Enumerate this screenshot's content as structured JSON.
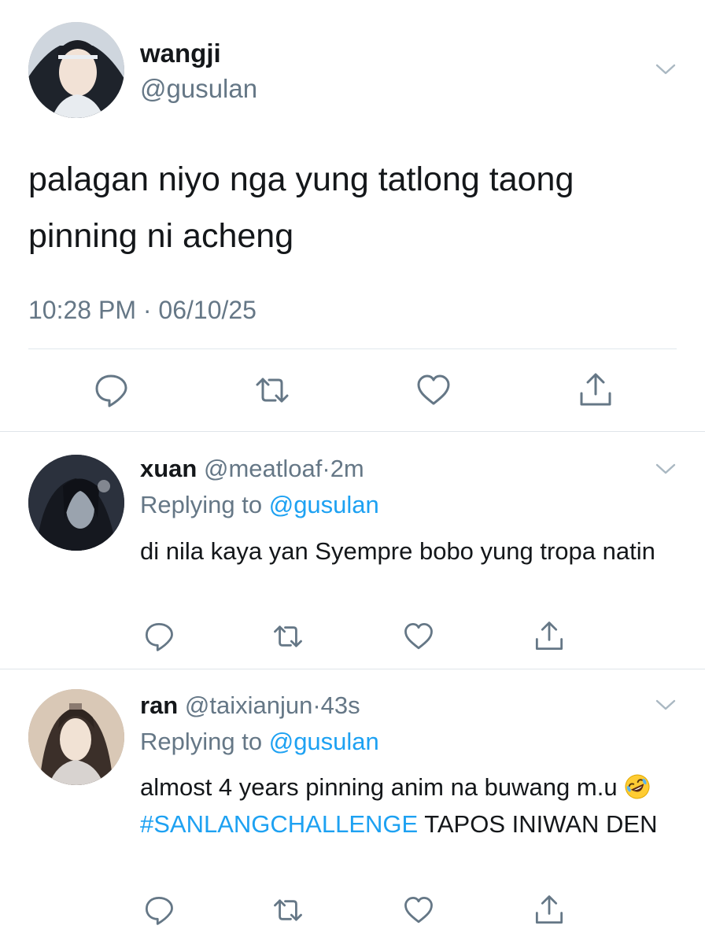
{
  "main_tweet": {
    "display_name": "wangji",
    "handle": "@gusulan",
    "text": "palagan niyo nga yung tatlong taong pinning ni acheng",
    "timestamp": "10:28 PM · 06/10/25",
    "avatar_icon": "profile-photo",
    "actions": [
      "reply-icon",
      "retweet-icon",
      "like-icon",
      "share-icon"
    ]
  },
  "replies": [
    {
      "display_name": "xuan",
      "handle": "@meatloaf",
      "time_sep": "·",
      "time": "2m",
      "replying_prefix": "Replying to",
      "replying_to": "@gusulan",
      "text": "di nila kaya yan Syempre bobo yung tropa natin"
    },
    {
      "display_name": "ran",
      "handle": "@taixianjun",
      "time_sep": "·",
      "time": "43s",
      "replying_prefix": "Replying to",
      "replying_to": "@gusulan",
      "text_part1": "almost 4 years pinning anim na buwang m.u",
      "emoji": "rolling-on-floor-laughing",
      "hashtag": "#SANLANGCHALLENGE",
      "text_part2": "TAPOS INIWAN DEN"
    }
  ],
  "colors": {
    "link": "#1da1f2",
    "secondary": "#657786",
    "primary_text": "#14171a",
    "divider": "#e1e8ed"
  }
}
